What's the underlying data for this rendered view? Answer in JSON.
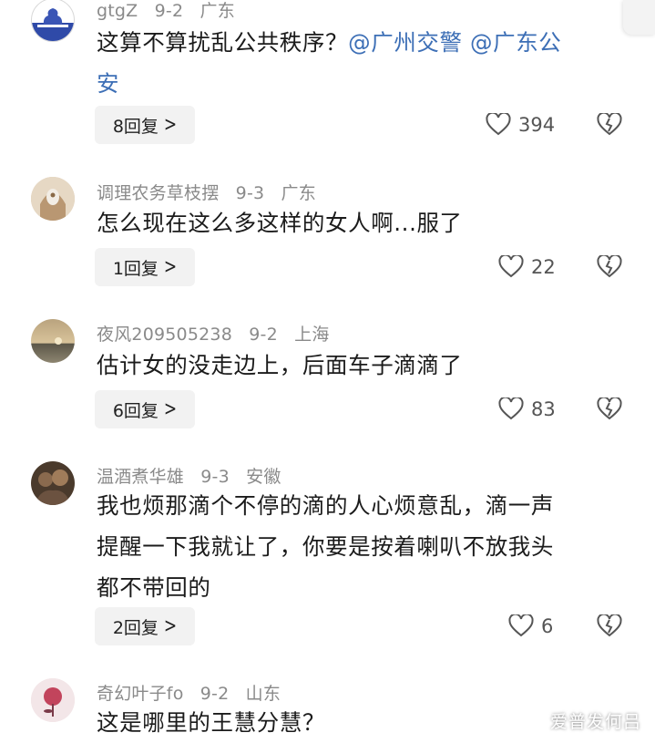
{
  "comments": [
    {
      "user": "gtgZ",
      "date": "9-2",
      "location": "广东",
      "text_plain": "这算不算扰乱公共秩序？",
      "mention1": "@广州交警",
      "mention2": "@广东公",
      "text_line2": "安",
      "replies": "8回复",
      "likes": "394"
    },
    {
      "user": "调理农务草枝摆",
      "date": "9-3",
      "location": "广东",
      "text": "怎么现在这么多这样的女人啊...服了",
      "replies": "1回复",
      "likes": "22"
    },
    {
      "user": "夜风209505238",
      "date": "9-2",
      "location": "上海",
      "text": "估计女的没走边上，后面车子滴滴了",
      "replies": "6回复",
      "likes": "83"
    },
    {
      "user": "温酒煮华雄",
      "date": "9-3",
      "location": "安徽",
      "text_lines": [
        "我也烦那滴个不停的滴的人心烦意乱，滴一声",
        "提醒一下我就让了，你要是按着喇叭不放我头",
        "都不带回的"
      ],
      "replies": "2回复",
      "likes": "6"
    },
    {
      "user": "奇幻叶子fo",
      "date": "9-2",
      "location": "山东",
      "text": "这是哪里的王慧分慧？"
    }
  ],
  "watermark": "爱普发何吕",
  "icons": {
    "reply_chevron": "chevron-right-icon",
    "like": "heart-outline-icon",
    "dislike": "broken-heart-icon"
  },
  "colors": {
    "mention": "#3d6fb6",
    "meta": "#8a8a8a",
    "reply_bg": "#f2f2f2"
  }
}
